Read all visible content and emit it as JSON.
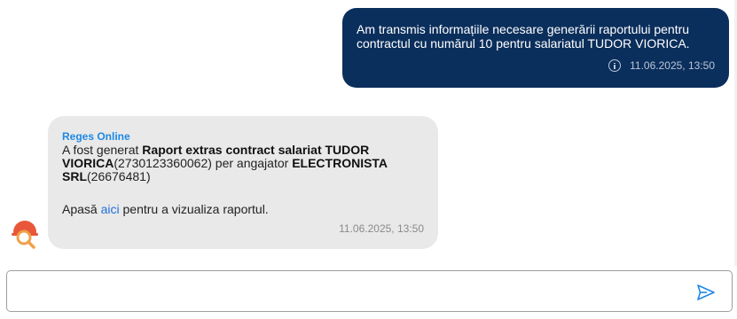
{
  "colors": {
    "outgoing_bubble": "#0b2f5c",
    "incoming_bubble": "#e9e9e9",
    "sender_name": "#1e88e5",
    "link": "#1e6fd9",
    "send_icon": "#1e88e5"
  },
  "messages": {
    "outgoing": {
      "text": "Am transmis informațiile necesare generării raportului pentru contractul cu numărul 10 pentru salariatul TUDOR VIORICA.",
      "info_icon": "info-icon",
      "timestamp": "11.06.2025, 13:50"
    },
    "incoming": {
      "sender": "Reges Online",
      "prefix": "A fost generat ",
      "report_title": "Raport extras contract salariat TUDOR VIORICA",
      "cnp": "(2730123360062)",
      "mid": " per angajator ",
      "employer": "ELECTRONISTA SRL",
      "cui": "(26676481)",
      "link_prefix": "Apasă ",
      "link_text": "aici",
      "link_suffix": " pentru a vizualiza raportul.",
      "timestamp": "11.06.2025, 13:50",
      "avatar_icon": "reges-bot-avatar-icon"
    }
  },
  "composer": {
    "placeholder": "",
    "value": "",
    "send_icon": "send-icon"
  }
}
